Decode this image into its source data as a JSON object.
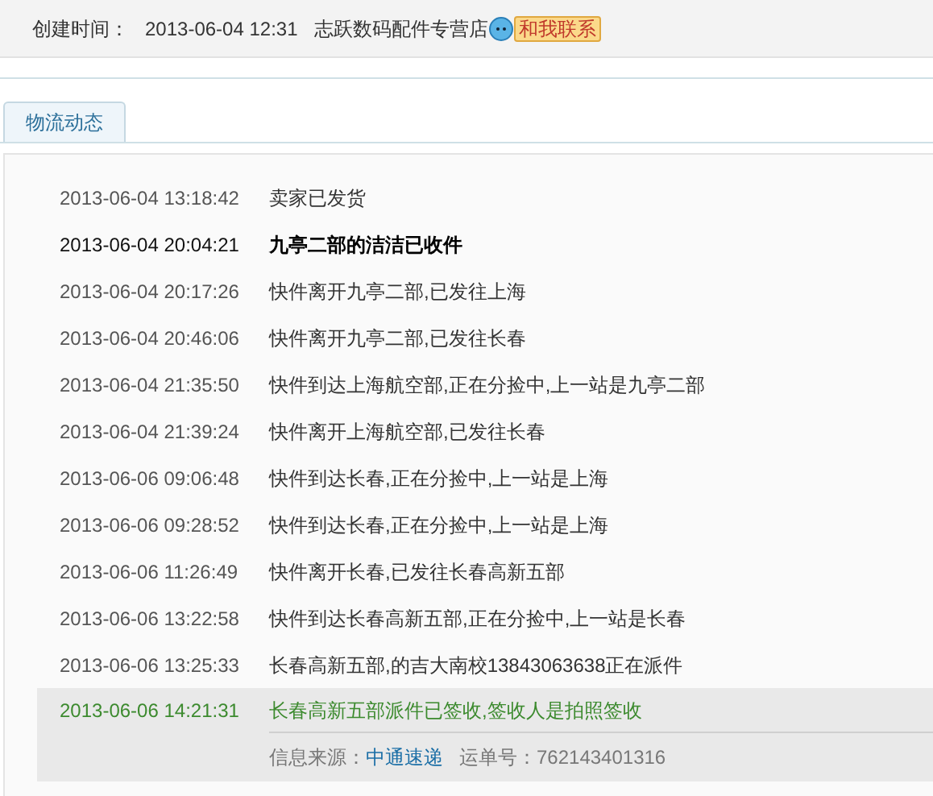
{
  "order": {
    "created_label": "创建时间：",
    "created_time": "2013-06-04 12:31",
    "shop": "志跃数码配件专营店",
    "contact": "和我联系"
  },
  "tabs": [
    {
      "label": "物流动态",
      "selected": true
    }
  ],
  "events": [
    {
      "time": "2013-06-04 13:18:42",
      "text": "卖家已发货",
      "kind": "normal"
    },
    {
      "time": "2013-06-04 20:04:21",
      "text": "九亭二部的洁洁已收件",
      "kind": "emphasis"
    },
    {
      "time": "2013-06-04 20:17:26",
      "text": "快件离开九亭二部,已发往上海",
      "kind": "normal"
    },
    {
      "time": "2013-06-04 20:46:06",
      "text": "快件离开九亭二部,已发往长春",
      "kind": "normal"
    },
    {
      "time": "2013-06-04 21:35:50",
      "text": "快件到达上海航空部,正在分捡中,上一站是九亭二部",
      "kind": "normal"
    },
    {
      "time": "2013-06-04 21:39:24",
      "text": "快件离开上海航空部,已发往长春",
      "kind": "normal"
    },
    {
      "time": "2013-06-06 09:06:48",
      "text": "快件到达长春,正在分捡中,上一站是上海",
      "kind": "normal"
    },
    {
      "time": "2013-06-06 09:28:52",
      "text": "快件到达长春,正在分捡中,上一站是上海",
      "kind": "normal"
    },
    {
      "time": "2013-06-06 11:26:49",
      "text": "快件离开长春,已发往长春高新五部",
      "kind": "normal"
    },
    {
      "time": "2013-06-06 13:22:58",
      "text": "快件到达长春高新五部,正在分捡中,上一站是长春",
      "kind": "normal"
    },
    {
      "time": "2013-06-06 13:25:33",
      "text": "长春高新五部,的吉大南校13843063638正在派件",
      "kind": "normal"
    },
    {
      "time": "2013-06-06 14:21:31",
      "text": "长春高新五部派件已签收,签收人是拍照签收",
      "kind": "latest"
    }
  ],
  "source": {
    "label": "信息来源：",
    "carrier": "中通速递",
    "waybill_label": "运单号：",
    "waybill": "762143401316"
  }
}
